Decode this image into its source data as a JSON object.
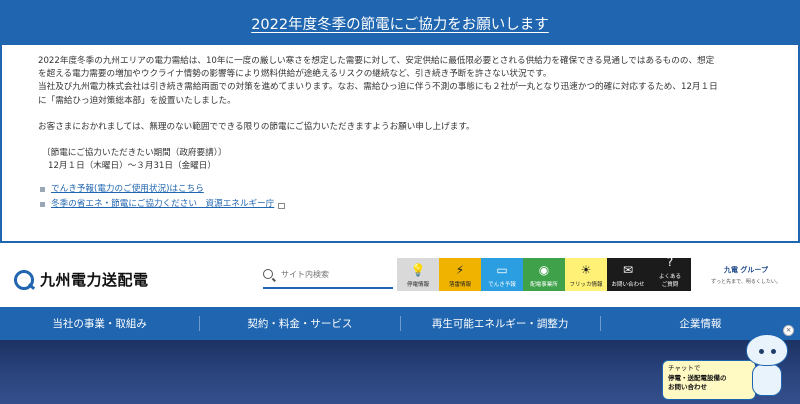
{
  "notice": {
    "title": "2022年度冬季の節電にご協力をお願いします",
    "paragraph1_line1": "2022年度冬季の九州エリアの電力需給は、10年に一度の厳しい寒さを想定した需要に対して、安定供給に最低限必要とされる供給力を確保できる見通しではあるものの、想定",
    "paragraph1_line2": "を超える電力需要の増加やウクライナ情勢の影響等により燃料供給が途絶えるリスクの継続など、引き続き予断を許さない状況です。",
    "paragraph2_line1": "当社及び九州電力株式会社は引き続き需給両面での対策を進めてまいります。なお、需給ひっ迫に伴う不測の事態にも２社が一丸となり迅速かつ的確に対応するため、12月１日",
    "paragraph2_line2": "に「需給ひっ迫対策総本部」を設置いたしました。",
    "request": "お客さまにおかれましては、無理のない範囲でできる限りの節電にご協力いただきますようお願い申し上げます。",
    "period_label": "〔節電にご協力いただきたい期間（政府要請）〕",
    "period_value": "12月１日（木曜日）～３月31日（金曜日）",
    "links": [
      "でんき予報(電力のご使用状況)はこちら",
      "冬季の省エネ・節電にご協力ください　資源エネルギー庁"
    ]
  },
  "header": {
    "logo_text": "九州電力送配電",
    "search_placeholder": "サイト内検索",
    "tiles": [
      {
        "label": "停電情報",
        "icon": "bulb-icon"
      },
      {
        "label": "落雷情報",
        "icon": "lightning-icon"
      },
      {
        "label": "でんき予報",
        "icon": "battery-icon"
      },
      {
        "label": "配電事業所",
        "icon": "location-pin-icon"
      },
      {
        "label": "フリッカ情報",
        "icon": "light-icon"
      },
      {
        "label": "お問い合わせ",
        "icon": "mail-icon"
      },
      {
        "label": "よくある\nご質問",
        "icon": "question-icon"
      }
    ],
    "group_logo_main": "九電 グループ",
    "group_logo_sub": "ずっと先まで、明るくしたい。"
  },
  "nav": {
    "items": [
      "当社の事業・取組み",
      "契約・料金・サービス",
      "再生可能エネルギー・調整力",
      "企業情報"
    ]
  },
  "chat": {
    "lead": "チャットで",
    "line2": "停電・送配電設備の",
    "line3": "お問い合わせ"
  },
  "colors": {
    "brand_blue": "#1f65b0",
    "tile_yellow": "#f0b400",
    "tile_blue": "#2a9ee0",
    "tile_green": "#3fa24a"
  }
}
